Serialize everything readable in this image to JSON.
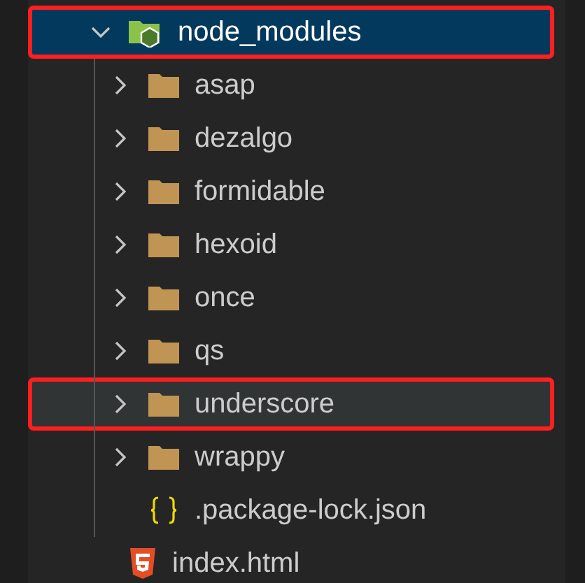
{
  "tree": [
    {
      "label": "node_modules",
      "kind": "node-folder",
      "expanded": true,
      "selected": true,
      "highlighted": true,
      "hovered": false,
      "children": [
        {
          "label": "asap",
          "kind": "folder",
          "expanded": false,
          "selected": false,
          "highlighted": false,
          "hovered": false
        },
        {
          "label": "dezalgo",
          "kind": "folder",
          "expanded": false,
          "selected": false,
          "highlighted": false,
          "hovered": false
        },
        {
          "label": "formidable",
          "kind": "folder",
          "expanded": false,
          "selected": false,
          "highlighted": false,
          "hovered": false
        },
        {
          "label": "hexoid",
          "kind": "folder",
          "expanded": false,
          "selected": false,
          "highlighted": false,
          "hovered": false
        },
        {
          "label": "once",
          "kind": "folder",
          "expanded": false,
          "selected": false,
          "highlighted": false,
          "hovered": false
        },
        {
          "label": "qs",
          "kind": "folder",
          "expanded": false,
          "selected": false,
          "highlighted": false,
          "hovered": false
        },
        {
          "label": "underscore",
          "kind": "folder",
          "expanded": false,
          "selected": false,
          "highlighted": true,
          "hovered": true
        },
        {
          "label": "wrappy",
          "kind": "folder",
          "expanded": false,
          "selected": false,
          "highlighted": false,
          "hovered": false
        },
        {
          "label": ".package-lock.json",
          "kind": "json",
          "selected": false,
          "highlighted": false,
          "hovered": false
        }
      ]
    },
    {
      "label": "index.html",
      "kind": "html",
      "selected": false,
      "highlighted": false,
      "hovered": false
    }
  ]
}
